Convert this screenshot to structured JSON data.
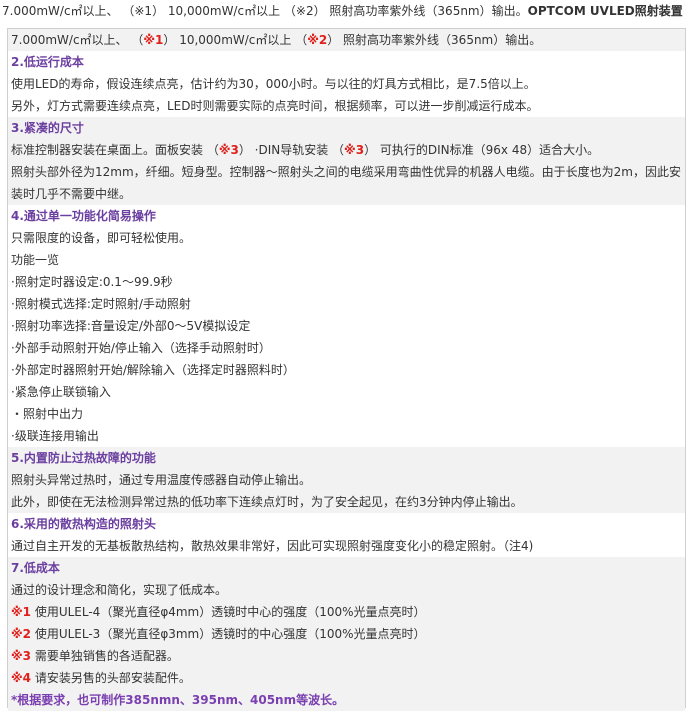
{
  "top_line": {
    "text1": "7.000mW/c㎡以上、 （",
    "n1": "※1",
    "text2": "） 10,000mW/c㎡以上 （",
    "n2": "※2",
    "text3": "） 照射高功率紫外线（365nm）输出。",
    "bold": "OPTCOM UVLED照射装置"
  },
  "row1": {
    "a": "7.000mW/c㎡以上、 （",
    "n1": "※1",
    "b": "） 10,000mW/c㎡以上 （",
    "n2": "※2",
    "c": "） 照射高功率紫外线（365nm）输出。"
  },
  "s2": {
    "title": "2.低运行成本",
    "l1": "使用LED的寿命，假设连续点亮，估计约为30，000小时。与以往的灯具方式相比，是7.5倍以上。",
    "l2": "另外，灯方式需要连续点亮，LED时则需要实际的点亮时间，根据频率，可以进一步削减运行成本。"
  },
  "s3": {
    "title": "3.紧凑的尺寸",
    "l1a": "标准控制器安装在桌面上。面板安装 （",
    "n3a": "※3",
    "l1b": "） ·DIN导轨安装 （",
    "n3b": "※3",
    "l1c": "） 可执行的DIN标准（96x 48）适合大小。",
    "l2": "照射头部外径为12mm，纤细。短身型。控制器～照射头之间的电缆采用弯曲性优异的机器人电缆。由于长度也为2m，因此安装时几乎不需要中继。"
  },
  "s4": {
    "title": "4.通过单一功能化简易操作",
    "l1": "只需限度的设备，即可轻松使用。",
    "l2": "功能一览",
    "items": [
      "·照射定时器设定:0.1～99.9秒",
      "·照射模式选择:定时照射/手动照射",
      "·照射功率选择:音量设定/外部0～5V模拟设定",
      "·外部手动照射开始/停止输入（选择手动照射时）",
      "·外部定时器照射开始/解除输入（选择定时器照料时）",
      "·紧急停止联锁输入",
      "・照射中出力",
      "·级联连接用输出"
    ]
  },
  "s5": {
    "title": "5.内置防止过热故障的功能",
    "l1": "照射头异常过热时，通过专用温度传感器自动停止输出。",
    "l2": "此外，即使在无法检测异常过热的低功率下连续点灯时，为了安全起见，在约3分钟内停止输出。"
  },
  "s6": {
    "title": "6.采用的散热构造的照射头",
    "l1": "通过自主开发的无基板散热结构，散热效果非常好，因此可实现照射强度变化小的稳定照射。（注4)"
  },
  "s7": {
    "title": "7.低成本",
    "l1": "通过的设计理念和简化，实现了低成本。",
    "notes": [
      {
        "mark": "※1",
        "text": " 使用ULEL-4（聚光直径φ4mm）透镜时中心的强度（100%光量点亮时）"
      },
      {
        "mark": "※2",
        "text": " 使用ULEL-3（聚光直径φ3mm）透镜时的中心强度（100%光量点亮时）"
      },
      {
        "mark": "※3",
        "text": " 需要单独销售的各适配器。"
      },
      {
        "mark": "※4",
        "text": " 请安装另售的头部安装配件。"
      }
    ],
    "footer": "*根据要求，也可制作385nmn、395nm、405nm等波长。"
  },
  "colors": {
    "heading": "#6b3fa0",
    "note_mark": "#e0201b",
    "footer": "#7a3fb0",
    "row_alt": "#f2f2f2"
  }
}
